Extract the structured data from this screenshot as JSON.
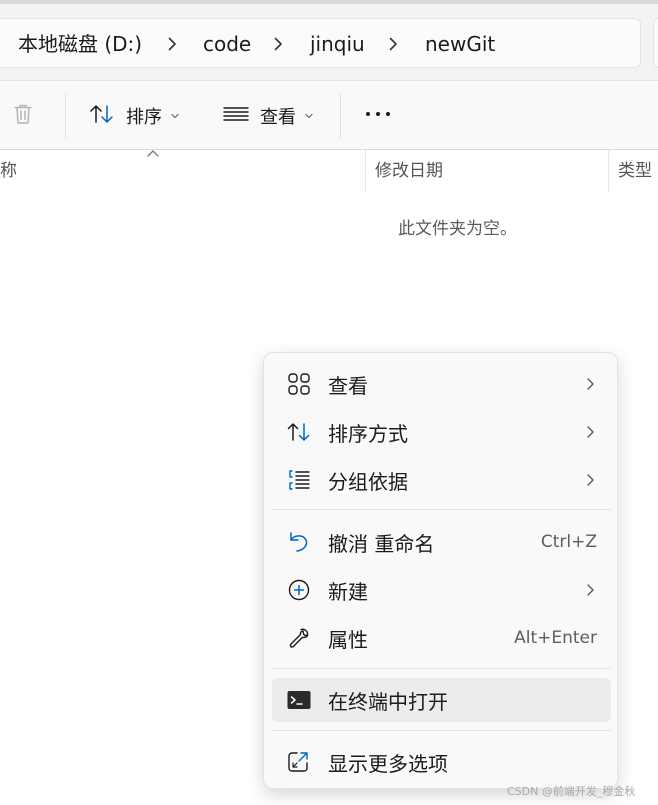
{
  "breadcrumb": {
    "items": [
      "本地磁盘 (D:)",
      "code",
      "jinqiu",
      "newGit"
    ]
  },
  "toolbar": {
    "sort_label": "排序",
    "view_label": "查看"
  },
  "columns": {
    "name": "称",
    "date_modified": "修改日期",
    "type": "类型"
  },
  "empty_message": "此文件夹为空。",
  "context_menu": {
    "items": [
      {
        "label": "查看",
        "icon": "grid-icon",
        "submenu": true
      },
      {
        "label": "排序方式",
        "icon": "sort-icon",
        "submenu": true
      },
      {
        "label": "分组依据",
        "icon": "group-list-icon",
        "submenu": true
      },
      {
        "label": "撤消 重命名",
        "icon": "undo-icon",
        "shortcut": "Ctrl+Z"
      },
      {
        "label": "新建",
        "icon": "plus-circle-icon",
        "submenu": true
      },
      {
        "label": "属性",
        "icon": "wrench-icon",
        "shortcut": "Alt+Enter"
      },
      {
        "label": "在终端中打开",
        "icon": "terminal-icon"
      },
      {
        "label": "显示更多选项",
        "icon": "external-open-icon"
      }
    ]
  },
  "watermark": "CSDN @前端开发_穆金秋",
  "colors": {
    "accent": "#0067c0",
    "menu_bg": "#f9f9f9",
    "toolbar_bg": "#f9f9f9"
  }
}
